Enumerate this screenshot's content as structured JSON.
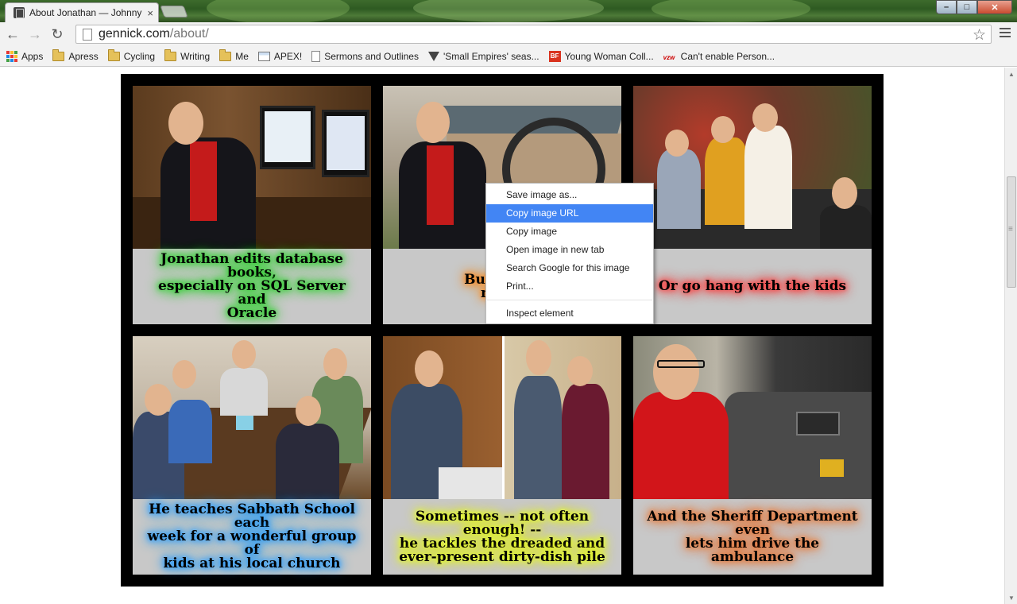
{
  "window": {
    "tab_title": "About Jonathan — Johnny",
    "tab_close": "×",
    "controls": {
      "minimize": "–",
      "maximize": "□",
      "close": "✕"
    }
  },
  "toolbar": {
    "url_host": "gennick.com",
    "url_path": "/about/",
    "back": "←",
    "forward": "→",
    "reload": "↻",
    "star": "☆"
  },
  "bookmarks": [
    {
      "label": "Apps",
      "icon": "apps-grid-icon"
    },
    {
      "label": "Apress",
      "icon": "folder-icon"
    },
    {
      "label": "Cycling",
      "icon": "folder-icon"
    },
    {
      "label": "Writing",
      "icon": "folder-icon"
    },
    {
      "label": "Me",
      "icon": "folder-icon"
    },
    {
      "label": "APEX!",
      "icon": "window-icon"
    },
    {
      "label": "Sermons and Outlines",
      "icon": "page-icon"
    },
    {
      "label": "'Small Empires' seas...",
      "icon": "triangle-icon"
    },
    {
      "label": "Young Woman Coll...",
      "icon": "bf-icon"
    },
    {
      "label": "Can't enable Person...",
      "icon": "vzw-icon"
    }
  ],
  "gallery": {
    "cells": [
      {
        "caption": [
          "Jonathan edits database books,",
          "especially on SQL Server and",
          "Oracle"
        ],
        "glow": "#33d233"
      },
      {
        "caption": [
          "But he'd r",
          "moun"
        ],
        "glow": "#ff8a1e"
      },
      {
        "caption": [
          "Or go hang with the kids"
        ],
        "glow": "#ff3a3a"
      },
      {
        "caption": [
          "He teaches Sabbath School each",
          "week for a wonderful group of",
          "kids at his local church"
        ],
        "glow": "#2a9dff"
      },
      {
        "caption": [
          "Sometimes -- not often enough! --",
          "he tackles the dreaded and",
          "ever-present dirty-dish pile"
        ],
        "glow": "#e6ff1a"
      },
      {
        "caption": [
          "And the Sheriff Department even",
          "lets him drive the ambulance"
        ],
        "glow": "#e87a3a"
      }
    ]
  },
  "context_menu": {
    "items": [
      {
        "label": "Save image as...",
        "highlighted": false
      },
      {
        "label": "Copy image URL",
        "highlighted": true
      },
      {
        "label": "Copy image",
        "highlighted": false
      },
      {
        "label": "Open image in new tab",
        "highlighted": false
      },
      {
        "label": "Search Google for this image",
        "highlighted": false
      },
      {
        "label": "Print...",
        "highlighted": false
      },
      {
        "label": "Inspect element",
        "highlighted": false
      }
    ]
  },
  "colors": {
    "menu_highlight": "#4285f4",
    "gallery_bg": "#000000",
    "caption_bg": "#c8c8c8"
  }
}
